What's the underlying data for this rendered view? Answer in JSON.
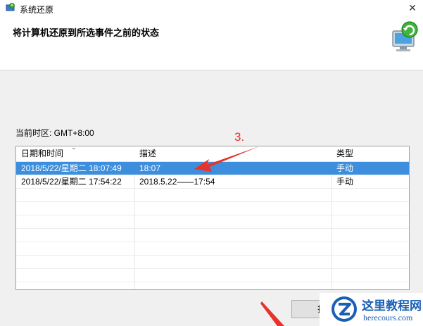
{
  "window": {
    "title": "系统还原",
    "close_glyph": "✕"
  },
  "header": {
    "heading": "将计算机还原到所选事件之前的状态",
    "icon": "system-restore-icon"
  },
  "timezone": {
    "text": "当前时区: GMT+8:00"
  },
  "table": {
    "columns": [
      "日期和时间",
      "描述",
      "类型"
    ],
    "rows": [
      {
        "datetime": "2018/5/22/星期二 18:07:49",
        "description": "18:07",
        "type": "手动",
        "selected": true
      },
      {
        "datetime": "2018/5/22/星期二 17:54:22",
        "description": "2018.5.22——17:54",
        "type": "手动",
        "selected": false
      }
    ]
  },
  "annotation": {
    "text": "3.",
    "color": "#e8322c"
  },
  "buttons": {
    "partial_label": "扫"
  },
  "watermark": {
    "title": "这里教程网",
    "url": "herecours.com",
    "color": "#1b5fb4"
  },
  "colors": {
    "selection": "#3d8fdd"
  }
}
